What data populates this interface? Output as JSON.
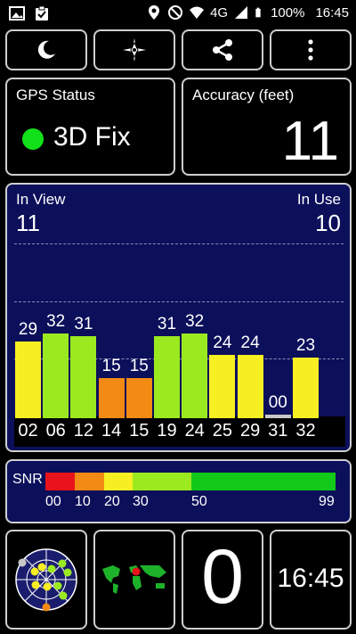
{
  "status_bar": {
    "network": "4G",
    "battery": "100%",
    "time": "16:45"
  },
  "toolbar": {
    "night_mode_icon": "moon-icon",
    "compass_icon": "compass-icon",
    "share_icon": "share-icon",
    "menu_icon": "more-vert-icon"
  },
  "gps_status": {
    "label": "GPS Status",
    "value": "3D Fix",
    "indicator_color": "#12e11a"
  },
  "accuracy": {
    "label": "Accuracy (feet)",
    "value": "11"
  },
  "satellites": {
    "in_view_label": "In View",
    "in_view": "11",
    "in_use_label": "In Use",
    "in_use": "10"
  },
  "chart_data": {
    "type": "bar",
    "categories": [
      "02",
      "06",
      "12",
      "14",
      "15",
      "19",
      "24",
      "25",
      "29",
      "31",
      "32"
    ],
    "values": [
      29,
      32,
      31,
      15,
      15,
      31,
      32,
      24,
      24,
      0,
      23
    ],
    "labels": [
      "29",
      "32",
      "31",
      "15",
      "15",
      "31",
      "32",
      "24",
      "24",
      "00",
      "23"
    ],
    "colors": [
      "#f7ef22",
      "#9bea1f",
      "#9bea1f",
      "#f28a14",
      "#f28a14",
      "#9bea1f",
      "#9bea1f",
      "#f7ef22",
      "#f7ef22",
      "#c8c8c8",
      "#f7ef22"
    ],
    "ylim": [
      0,
      60
    ],
    "grid": true
  },
  "snr": {
    "label": "SNR",
    "ticks": [
      "00",
      "10",
      "20",
      "30",
      "50",
      "99"
    ],
    "colors": [
      "#e8131b",
      "#f28a14",
      "#f7ef22",
      "#9bea1f",
      "#12c919"
    ]
  },
  "bottom": {
    "radar_icon": "sky-plot-icon",
    "map_icon": "world-map-icon",
    "counter": "0",
    "clock": "16:45"
  }
}
